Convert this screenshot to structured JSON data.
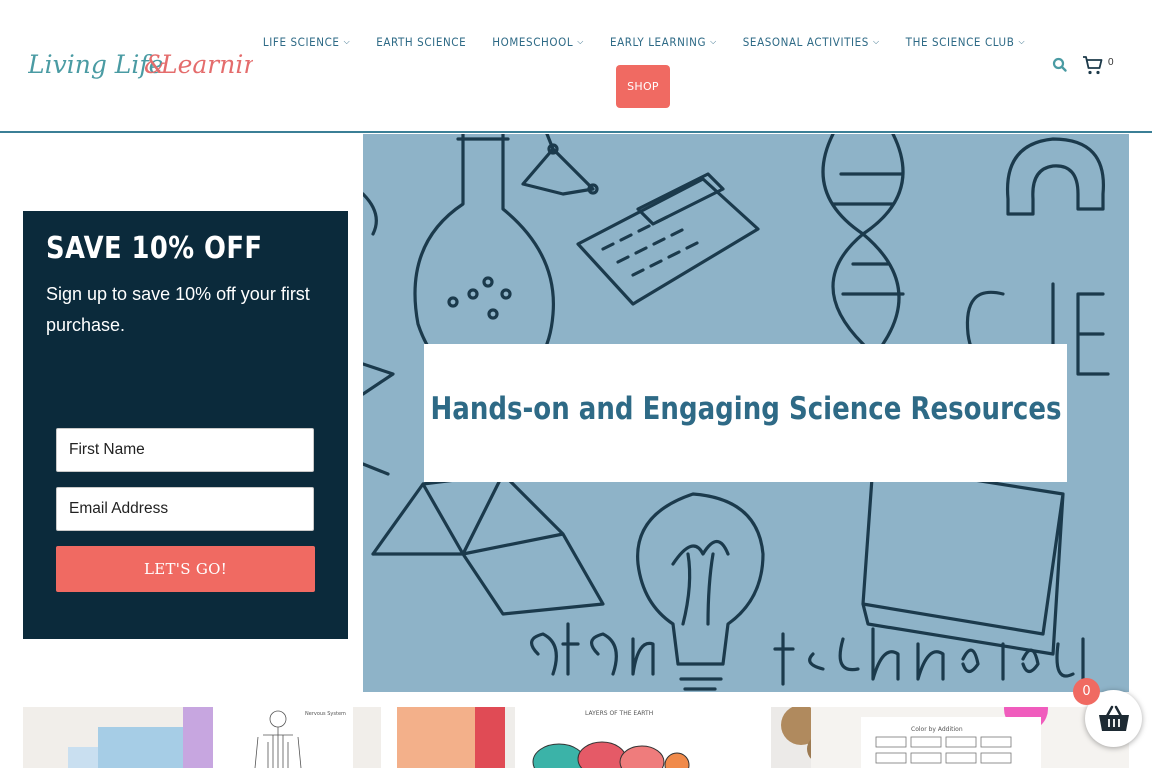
{
  "header": {
    "logo_text": "Living Life & Learning",
    "nav": [
      {
        "label": "LIFE SCIENCE",
        "dropdown": true
      },
      {
        "label": "EARTH SCIENCE",
        "dropdown": false
      },
      {
        "label": "HOMESCHOOL",
        "dropdown": true
      },
      {
        "label": "EARLY LEARNING",
        "dropdown": true
      },
      {
        "label": "SEASONAL ACTIVITIES",
        "dropdown": true
      },
      {
        "label": "THE SCIENCE CLUB",
        "dropdown": true
      }
    ],
    "shop_label": "SHOP",
    "search_icon": "search-icon",
    "cart_icon": "cart-icon",
    "cart_count": "0",
    "accent_color": "#2e6a86",
    "brand_coral": "#f06a62"
  },
  "signup": {
    "title": "SAVE 10% OFF",
    "text": "Sign up to save 10% off your first purchase.",
    "first_name_placeholder": "First Name",
    "email_placeholder": "Email Address",
    "button_label": "LET'S GO!",
    "background": "#0b2a3b"
  },
  "hero": {
    "title": "Hands-on and Engaging Science Resources",
    "background": "#8eb3c8"
  },
  "thumbnails": [
    {
      "caption": "Nervous System"
    },
    {
      "caption": "LAYERS OF THE EARTH"
    },
    {
      "caption": "Color by Addition"
    }
  ],
  "floating_cart": {
    "count": "0"
  }
}
